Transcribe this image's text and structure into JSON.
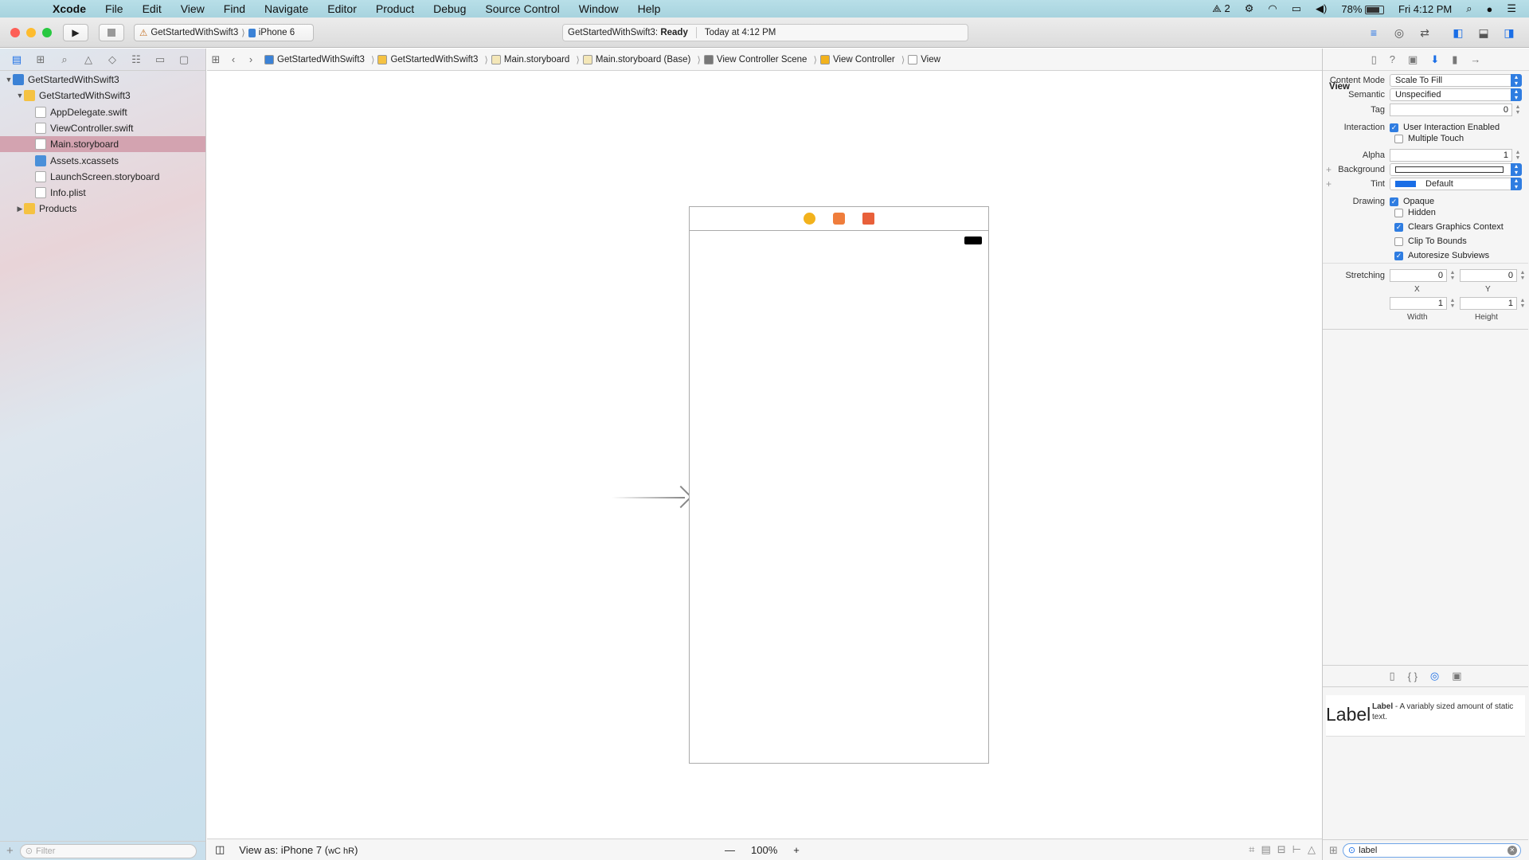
{
  "menubar": {
    "apple": "",
    "items": [
      "Xcode",
      "File",
      "Edit",
      "View",
      "Find",
      "Navigate",
      "Editor",
      "Product",
      "Debug",
      "Source Control",
      "Window",
      "Help"
    ],
    "status_count": "2",
    "battery": "78%",
    "clock": "Fri 4:12 PM"
  },
  "toolbar": {
    "scheme": "GetStartedWithSwift3",
    "scheme_sep": "⟩",
    "device": "iPhone 6",
    "status_project": "GetStartedWithSwift3:",
    "status_state": "Ready",
    "status_time": "Today at 4:12 PM"
  },
  "navigator": {
    "tree": [
      {
        "label": "GetStartedWithSwift3",
        "type": "proj",
        "indent": 0,
        "disclosure": "▼",
        "selected": false
      },
      {
        "label": "GetStartedWithSwift3",
        "type": "folder",
        "indent": 1,
        "disclosure": "▼",
        "selected": false
      },
      {
        "label": "AppDelegate.swift",
        "type": "doc",
        "indent": 2,
        "disclosure": "",
        "selected": false
      },
      {
        "label": "ViewController.swift",
        "type": "doc",
        "indent": 2,
        "disclosure": "",
        "selected": false
      },
      {
        "label": "Main.storyboard",
        "type": "doc",
        "indent": 2,
        "disclosure": "",
        "selected": true
      },
      {
        "label": "Assets.xcassets",
        "type": "assets",
        "indent": 2,
        "disclosure": "",
        "selected": false
      },
      {
        "label": "LaunchScreen.storyboard",
        "type": "doc",
        "indent": 2,
        "disclosure": "",
        "selected": false
      },
      {
        "label": "Info.plist",
        "type": "doc",
        "indent": 2,
        "disclosure": "",
        "selected": false
      },
      {
        "label": "Products",
        "type": "folder",
        "indent": 1,
        "disclosure": "▶",
        "selected": false
      }
    ],
    "filter_placeholder": "Filter"
  },
  "jumpbar": {
    "crumbs": [
      {
        "label": "GetStartedWithSwift3",
        "color": "#3b82d6"
      },
      {
        "label": "GetStartedWithSwift3",
        "color": "#f5c242"
      },
      {
        "label": "Main.storyboard",
        "color": "#f4e7b8"
      },
      {
        "label": "Main.storyboard (Base)",
        "color": "#f4e7b8"
      },
      {
        "label": "View Controller Scene",
        "color": "#777777"
      },
      {
        "label": "View Controller",
        "color": "#f2b21c"
      },
      {
        "label": "View",
        "color": "#ffffff"
      }
    ]
  },
  "canvas": {
    "view_as": "View as: iPhone 7 (",
    "size_class": "wC hR",
    "view_as_end": ")",
    "zoom_minus": "—",
    "zoom_level": "100%",
    "zoom_plus": "+"
  },
  "inspector": {
    "section_title": "View",
    "content_mode_label": "Content Mode",
    "content_mode_value": "Scale To Fill",
    "semantic_label": "Semantic",
    "semantic_value": "Unspecified",
    "tag_label": "Tag",
    "tag_value": "0",
    "interaction_label": "Interaction",
    "user_interaction": "User Interaction Enabled",
    "multiple_touch": "Multiple Touch",
    "alpha_label": "Alpha",
    "alpha_value": "1",
    "background_label": "Background",
    "tint_label": "Tint",
    "tint_value": "Default",
    "drawing_label": "Drawing",
    "opaque": "Opaque",
    "hidden": "Hidden",
    "clears_graphics": "Clears Graphics Context",
    "clip_bounds": "Clip To Bounds",
    "autoresize": "Autoresize Subviews",
    "stretching_label": "Stretching",
    "stretch_x": "0",
    "stretch_y": "0",
    "stretch_w": "1",
    "stretch_h": "1",
    "caption_x": "X",
    "caption_y": "Y",
    "caption_w": "Width",
    "caption_h": "Height",
    "checks": {
      "user_interaction": true,
      "multiple_touch": false,
      "opaque": true,
      "hidden": false,
      "clears_graphics": true,
      "clip_bounds": false,
      "autoresize": true
    },
    "tint_color": "#1a6ee6"
  },
  "library": {
    "item_big": "Label",
    "item_name": "Label",
    "item_desc": " - A variably sized amount of static text.",
    "search_value": "label"
  },
  "colors": {
    "accent": "#1a6ee6",
    "selection": "#d3a3b0",
    "traffic_close": "#fd5f57",
    "traffic_min": "#febc2e",
    "traffic_max": "#28c840"
  }
}
